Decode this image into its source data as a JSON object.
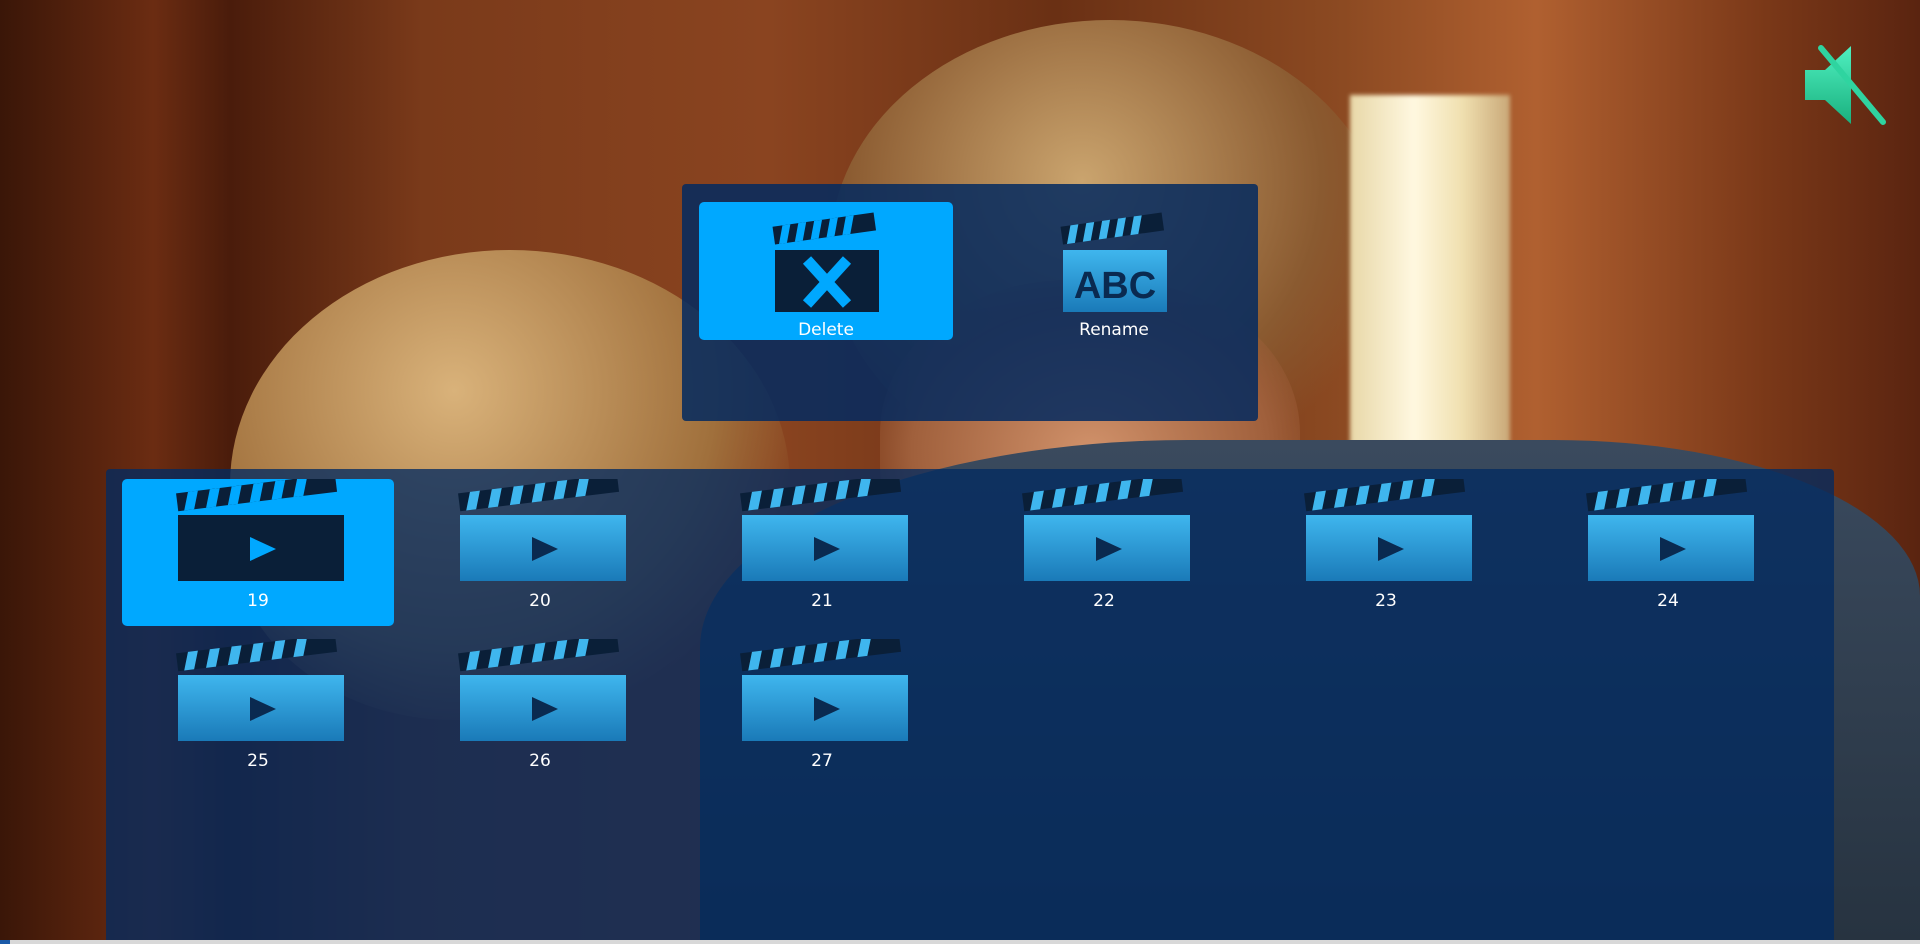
{
  "context_menu": {
    "items": [
      {
        "label": "Delete",
        "icon": "clapper-delete-icon",
        "selected": true
      },
      {
        "label": "Rename",
        "icon": "clapper-abc-icon",
        "selected": false
      }
    ],
    "rename_icon_text": "ABC"
  },
  "grid": {
    "items": [
      {
        "label": "19",
        "selected": true
      },
      {
        "label": "20",
        "selected": false
      },
      {
        "label": "21",
        "selected": false
      },
      {
        "label": "22",
        "selected": false
      },
      {
        "label": "23",
        "selected": false
      },
      {
        "label": "24",
        "selected": false
      },
      {
        "label": "25",
        "selected": false
      },
      {
        "label": "26",
        "selected": false
      },
      {
        "label": "27",
        "selected": false
      }
    ]
  },
  "colors": {
    "accent": "#00a8ff",
    "panel": "#032a60",
    "icon_light": "#3fb6ee",
    "icon_dark": "#0a1f38",
    "mute_icon": "#2fd4a0"
  }
}
